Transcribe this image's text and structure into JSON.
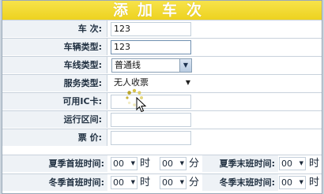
{
  "window": {
    "title": "添加车次"
  },
  "form": {
    "fields": [
      {
        "label": "车 次:",
        "value": "123"
      },
      {
        "label": "车辆类型:",
        "value": "123"
      },
      {
        "label": "车线类型:",
        "value": "普通线"
      },
      {
        "label": "服务类型:",
        "value": "无人收票"
      },
      {
        "label": "可用IC卡:",
        "value": ""
      },
      {
        "label": "运行区间:",
        "value": ""
      },
      {
        "label": "票 价:",
        "value": ""
      }
    ],
    "summer": {
      "first_label": "夏季首班时间:",
      "first_hour": "00",
      "first_min": "00",
      "last_label": "夏季末班时间:",
      "last_hour": "00"
    },
    "winter": {
      "first_label": "冬季首班时间:",
      "first_hour": "00",
      "first_min": "00",
      "last_label": "冬季末班时间:",
      "last_hour": "00"
    },
    "units": {
      "hour": "时",
      "minute": "分"
    }
  },
  "colors": {
    "title_bg": "#f0d62a",
    "label_bg": "#eef2f6",
    "border": "#c8d2dc"
  },
  "icons": {
    "dropdown": "chevron-down-icon",
    "loading": "spinner-icon",
    "pointer": "cursor-icon"
  }
}
